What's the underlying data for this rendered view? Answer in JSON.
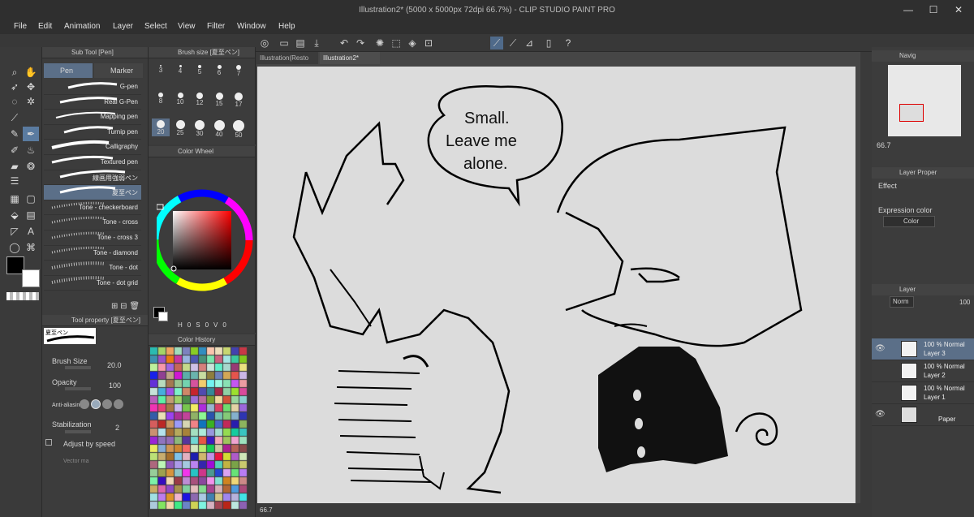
{
  "window": {
    "title": "Illustration2* (5000 x 5000px 72dpi 66.7%) - CLIP STUDIO PAINT PRO",
    "buttons": [
      "—",
      "☐",
      "✕"
    ]
  },
  "menu": [
    "File",
    "Edit",
    "Animation",
    "Layer",
    "Select",
    "View",
    "Filter",
    "Window",
    "Help"
  ],
  "subtool": {
    "panel_title": "Sub Tool [Pen]",
    "tabs": [
      "Pen",
      "Marker"
    ],
    "brushes": [
      "G-pen",
      "Real G-Pen",
      "Mapping pen",
      "Turnip pen",
      "Calligraphy",
      "Textured pen",
      "線画用強弱ペン",
      "夏至ペン",
      "Tone - checkerboard",
      "Tone - cross",
      "Tone - cross 3",
      "Tone - diamond",
      "Tone - dot",
      "Tone - dot grid"
    ]
  },
  "brush_size": {
    "panel_title": "Brush size [夏至ペン]",
    "sizes": [
      "3",
      "4",
      "5",
      "6",
      "7",
      "8",
      "10",
      "12",
      "15",
      "17",
      "20",
      "25",
      "30",
      "40",
      "50"
    ]
  },
  "color_wheel": {
    "panel_title": "Color Wheel",
    "readout": [
      "H",
      "0",
      "S",
      "0",
      "V",
      "0"
    ]
  },
  "tool_property": {
    "panel_title": "Tool property [夏至ペン]",
    "brush_name": "夏至ペン",
    "brush_size_label": "Brush Size",
    "brush_size_value": "20.0",
    "opacity_label": "Opacity",
    "opacity_value": "100",
    "antialias_label": "Anti-aliasin",
    "stabilization_label": "Stabilization",
    "stabilization_value": "2",
    "adjust_label": "Adjust by speed",
    "vector_label": "Vector ma"
  },
  "color_history": {
    "panel_title": "Color History"
  },
  "document_tabs": [
    "Illustration(Resto",
    "Illustration2*"
  ],
  "status": {
    "zoom": "66.7"
  },
  "speech_bubble": {
    "line1": "Small.",
    "line2": "Leave me",
    "line3": "alone."
  },
  "navigator": {
    "title": "Navig",
    "zoom": "66.7"
  },
  "layer_property": {
    "title": "Layer Proper",
    "effect_label": "Effect",
    "expression_label": "Expression color",
    "expression_value": "Color"
  },
  "layers_panel": {
    "title": "Layer",
    "blend_value": "Norm",
    "opacity_value": "100",
    "layers": [
      {
        "line1": "100 % Normal",
        "line2": "Layer 3"
      },
      {
        "line1": "100 % Normal",
        "line2": "Layer 2"
      },
      {
        "line1": "100 % Normal",
        "line2": "Layer 1"
      },
      {
        "line1": "",
        "line2": "Paper"
      }
    ]
  },
  "colors": {
    "panel": "#3c3c3c",
    "selection": "#5b6f88",
    "paper": "#dcdcdc",
    "accent": "#5a7ba0"
  }
}
